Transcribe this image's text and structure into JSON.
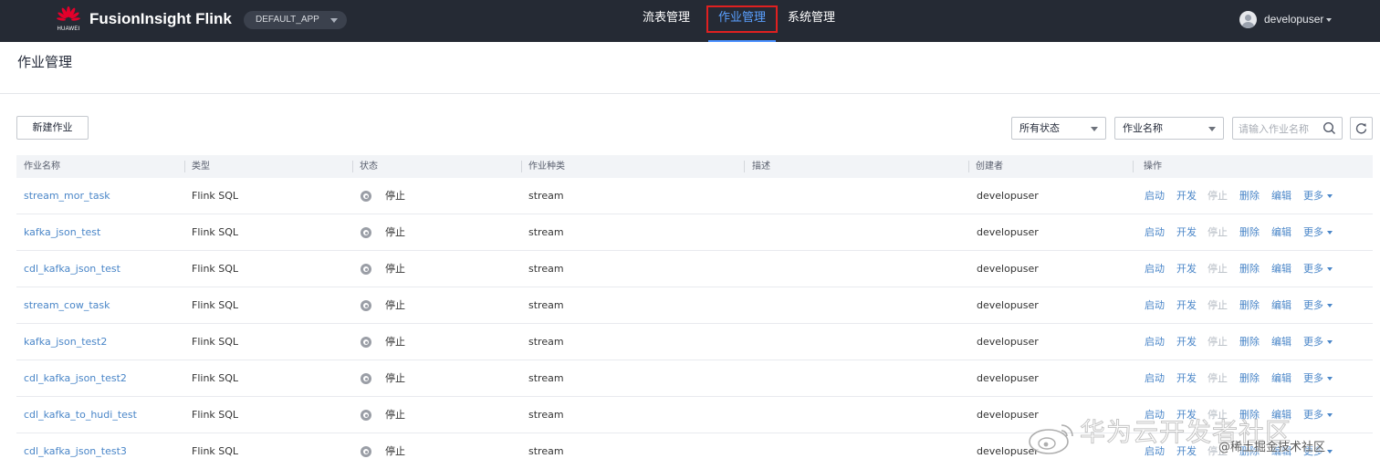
{
  "header": {
    "brand_text": "HUAWEI",
    "app_title": "FusionInsight Flink",
    "app_selector": "DEFAULT_APP",
    "nav": [
      {
        "label": "流表管理",
        "active": false
      },
      {
        "label": "作业管理",
        "active": true
      },
      {
        "label": "系统管理",
        "active": false
      }
    ],
    "user": "developuser",
    "accent_color": "#5aa0ff",
    "highlight_color": "#e02020"
  },
  "page": {
    "title": "作业管理"
  },
  "toolbar": {
    "new_button": "新建作业",
    "status_filter": "所有状态",
    "field_filter": "作业名称",
    "search_placeholder": "请输入作业名称",
    "search_icon": "search-icon",
    "refresh_icon": "refresh-icon"
  },
  "table": {
    "columns": [
      "作业名称",
      "类型",
      "状态",
      "作业种类",
      "描述",
      "创建者",
      "操作"
    ],
    "rows": [
      {
        "name": "stream_mor_task",
        "type": "Flink SQL",
        "status": "停止",
        "kind": "stream",
        "desc": "",
        "creator": "developuser"
      },
      {
        "name": "kafka_json_test",
        "type": "Flink SQL",
        "status": "停止",
        "kind": "stream",
        "desc": "",
        "creator": "developuser"
      },
      {
        "name": "cdl_kafka_json_test",
        "type": "Flink SQL",
        "status": "停止",
        "kind": "stream",
        "desc": "",
        "creator": "developuser"
      },
      {
        "name": "stream_cow_task",
        "type": "Flink SQL",
        "status": "停止",
        "kind": "stream",
        "desc": "",
        "creator": "developuser"
      },
      {
        "name": "kafka_json_test2",
        "type": "Flink SQL",
        "status": "停止",
        "kind": "stream",
        "desc": "",
        "creator": "developuser"
      },
      {
        "name": "cdl_kafka_json_test2",
        "type": "Flink SQL",
        "status": "停止",
        "kind": "stream",
        "desc": "",
        "creator": "developuser"
      },
      {
        "name": "cdl_kafka_to_hudi_test",
        "type": "Flink SQL",
        "status": "停止",
        "kind": "stream",
        "desc": "",
        "creator": "developuser"
      },
      {
        "name": "cdl_kafka_json_test3",
        "type": "Flink SQL",
        "status": "停止",
        "kind": "stream",
        "desc": "",
        "creator": "developuser"
      }
    ],
    "actions": {
      "start": "启动",
      "develop": "开发",
      "stop": "停止",
      "delete": "删除",
      "edit": "编辑",
      "more": "更多"
    },
    "link_color": "#4a86c8",
    "disabled_color": "#b6bcc4"
  },
  "watermark": {
    "main": "华为云开发者社区",
    "sub": "@稀土掘金技术社区"
  }
}
